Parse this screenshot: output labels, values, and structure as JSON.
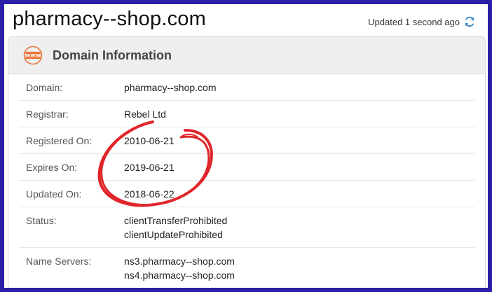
{
  "header": {
    "site_title": "pharmacy--shop.com",
    "updated_text": "Updated 1 second ago",
    "refresh_icon": "refresh-icon"
  },
  "card": {
    "icon": "www-icon",
    "icon_text": "WWW",
    "title": "Domain Information"
  },
  "fields": {
    "domain": {
      "label": "Domain:",
      "value": "pharmacy--shop.com"
    },
    "registrar": {
      "label": "Registrar:",
      "value": "Rebel Ltd"
    },
    "registered_on": {
      "label": "Registered On:",
      "value": "2010-06-21"
    },
    "expires_on": {
      "label": "Expires On:",
      "value": "2019-06-21"
    },
    "updated_on": {
      "label": "Updated On:",
      "value": "2018-06-22"
    },
    "status": {
      "label": "Status:",
      "values": [
        "clientTransferProhibited",
        "clientUpdateProhibited"
      ]
    },
    "name_servers": {
      "label": "Name Servers:",
      "values": [
        "ns3.pharmacy--shop.com",
        "ns4.pharmacy--shop.com"
      ]
    }
  },
  "colors": {
    "border_frame": "#2a1fa6",
    "accent_orange": "#e8743b",
    "refresh_blue": "#3a86c8",
    "annotation_red": "#e0262b"
  }
}
